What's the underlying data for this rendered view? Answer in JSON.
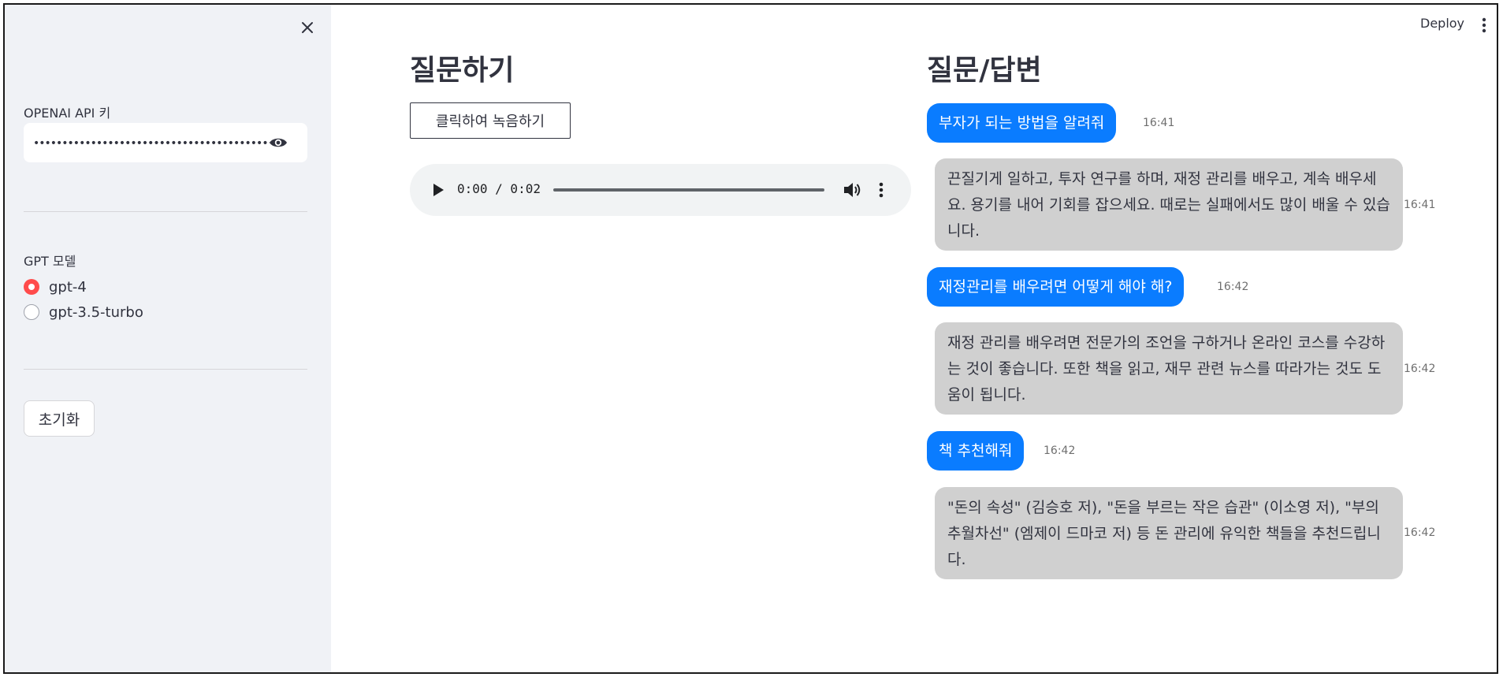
{
  "sidebar": {
    "api_key_label": "OPENAI API 키",
    "api_key_value": "••••••••••••••••••••••••••••••••••••••••••••••••••••",
    "model_label": "GPT 모델",
    "models": [
      {
        "label": "gpt-4",
        "selected": true
      },
      {
        "label": "gpt-3.5-turbo",
        "selected": false
      }
    ],
    "reset_label": "초기화"
  },
  "header": {
    "deploy_label": "Deploy"
  },
  "ask": {
    "title": "질문하기",
    "record_label": "클릭하여  녹음하기",
    "audio_time": "0:00 / 0:02"
  },
  "chat": {
    "title": "질문/답변",
    "messages": [
      {
        "role": "user",
        "text": "부자가 되는 방법을 알려줘",
        "time": "16:41"
      },
      {
        "role": "assistant",
        "text": "끈질기게 일하고, 투자 연구를 하며, 재정 관리를 배우고, 계속 배우세요. 용기를 내어 기회를 잡으세요. 때로는 실패에서도 많이 배울 수 있습니다.",
        "time": "16:41"
      },
      {
        "role": "user",
        "text": "재정관리를 배우려면 어떻게 해야 해?",
        "time": "16:42"
      },
      {
        "role": "assistant",
        "text": "재정 관리를 배우려면 전문가의 조언을 구하거나 온라인 코스를 수강하는 것이 좋습니다. 또한 책을 읽고, 재무 관련 뉴스를 따라가는 것도 도움이 됩니다.",
        "time": "16:42"
      },
      {
        "role": "user",
        "text": "책 추천해줘",
        "time": "16:42"
      },
      {
        "role": "assistant",
        "text": "\"돈의 속성\" (김승호 저), \"돈을 부르는 작은 습관\" (이소영 저), \"부의 추월차선\" (엠제이 드마코 저) 등 돈 관리에 유익한 책들을 추천드립니다.",
        "time": "16:42"
      }
    ]
  },
  "colors": {
    "sidebar_bg": "#f0f2f6",
    "user_bubble": "#0a7cff",
    "assistant_bubble": "#d0d0d0",
    "radio_selected": "#ff4b4b"
  }
}
